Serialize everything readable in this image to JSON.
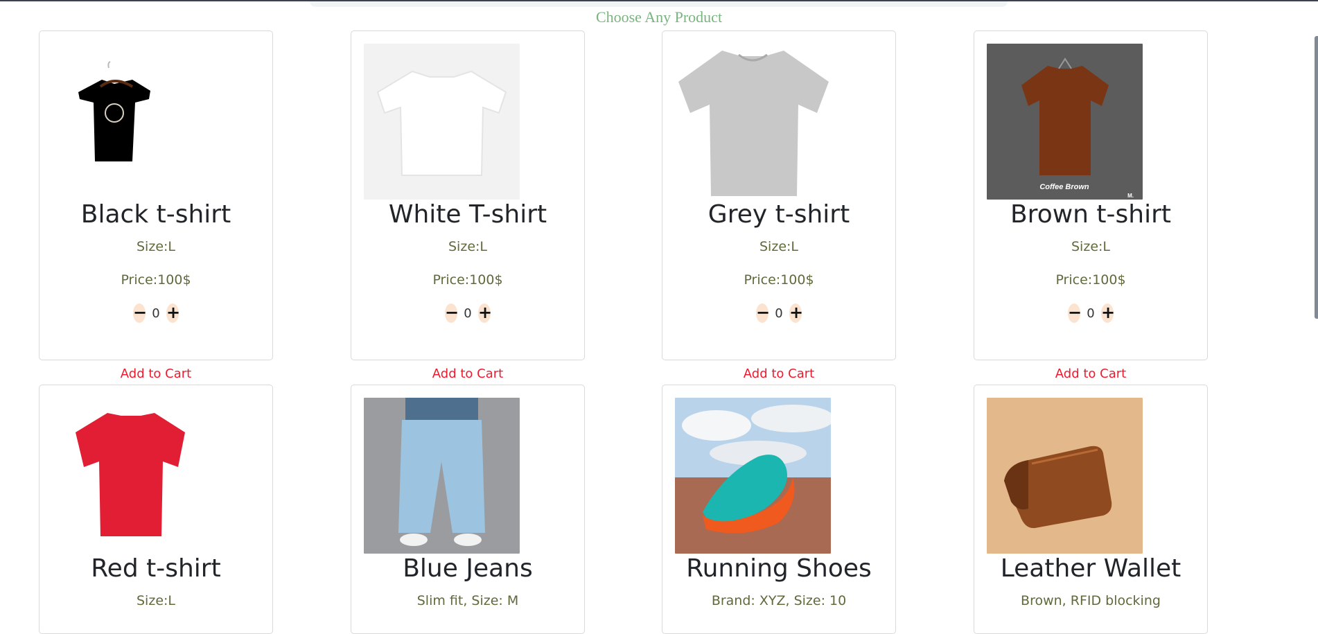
{
  "page": {
    "heading": "Choose Any Product"
  },
  "products": [
    {
      "title": "Black t-shirt",
      "desc": "Size:L",
      "price": "Price:100$",
      "qty": "0",
      "add": "Add to Cart",
      "minus": "−",
      "plus": "+",
      "image": "black-tshirt-image"
    },
    {
      "title": "White T-shirt",
      "desc": "Size:L",
      "price": "Price:100$",
      "qty": "0",
      "add": "Add to Cart",
      "minus": "−",
      "plus": "+",
      "image": "white-tshirt-image"
    },
    {
      "title": "Grey t-shirt",
      "desc": "Size:L",
      "price": "Price:100$",
      "qty": "0",
      "add": "Add to Cart",
      "minus": "−",
      "plus": "+",
      "image": "grey-tshirt-image"
    },
    {
      "title": "Brown t-shirt",
      "desc": "Size:L",
      "price": "Price:100$",
      "qty": "0",
      "add": "Add to Cart",
      "minus": "−",
      "plus": "+",
      "image": "brown-tshirt-image",
      "image_caption": "Coffee Brown",
      "image_mark": "M."
    },
    {
      "title": "Red t-shirt",
      "desc": "Size:L",
      "image": "red-tshirt-image"
    },
    {
      "title": "Blue Jeans",
      "desc": "Slim fit, Size: M",
      "image": "blue-jeans-image"
    },
    {
      "title": "Running Shoes",
      "desc": "Brand: XYZ, Size: 10",
      "image": "running-shoes-image"
    },
    {
      "title": "Leather Wallet",
      "desc": "Brown, RFID blocking",
      "image": "leather-wallet-image"
    }
  ],
  "colors": {
    "heading": "#7ab37f",
    "add_to_cart": "#f0192e",
    "detail_text": "#5e6a3a",
    "qty_button_bg": "#fbe3cf"
  }
}
